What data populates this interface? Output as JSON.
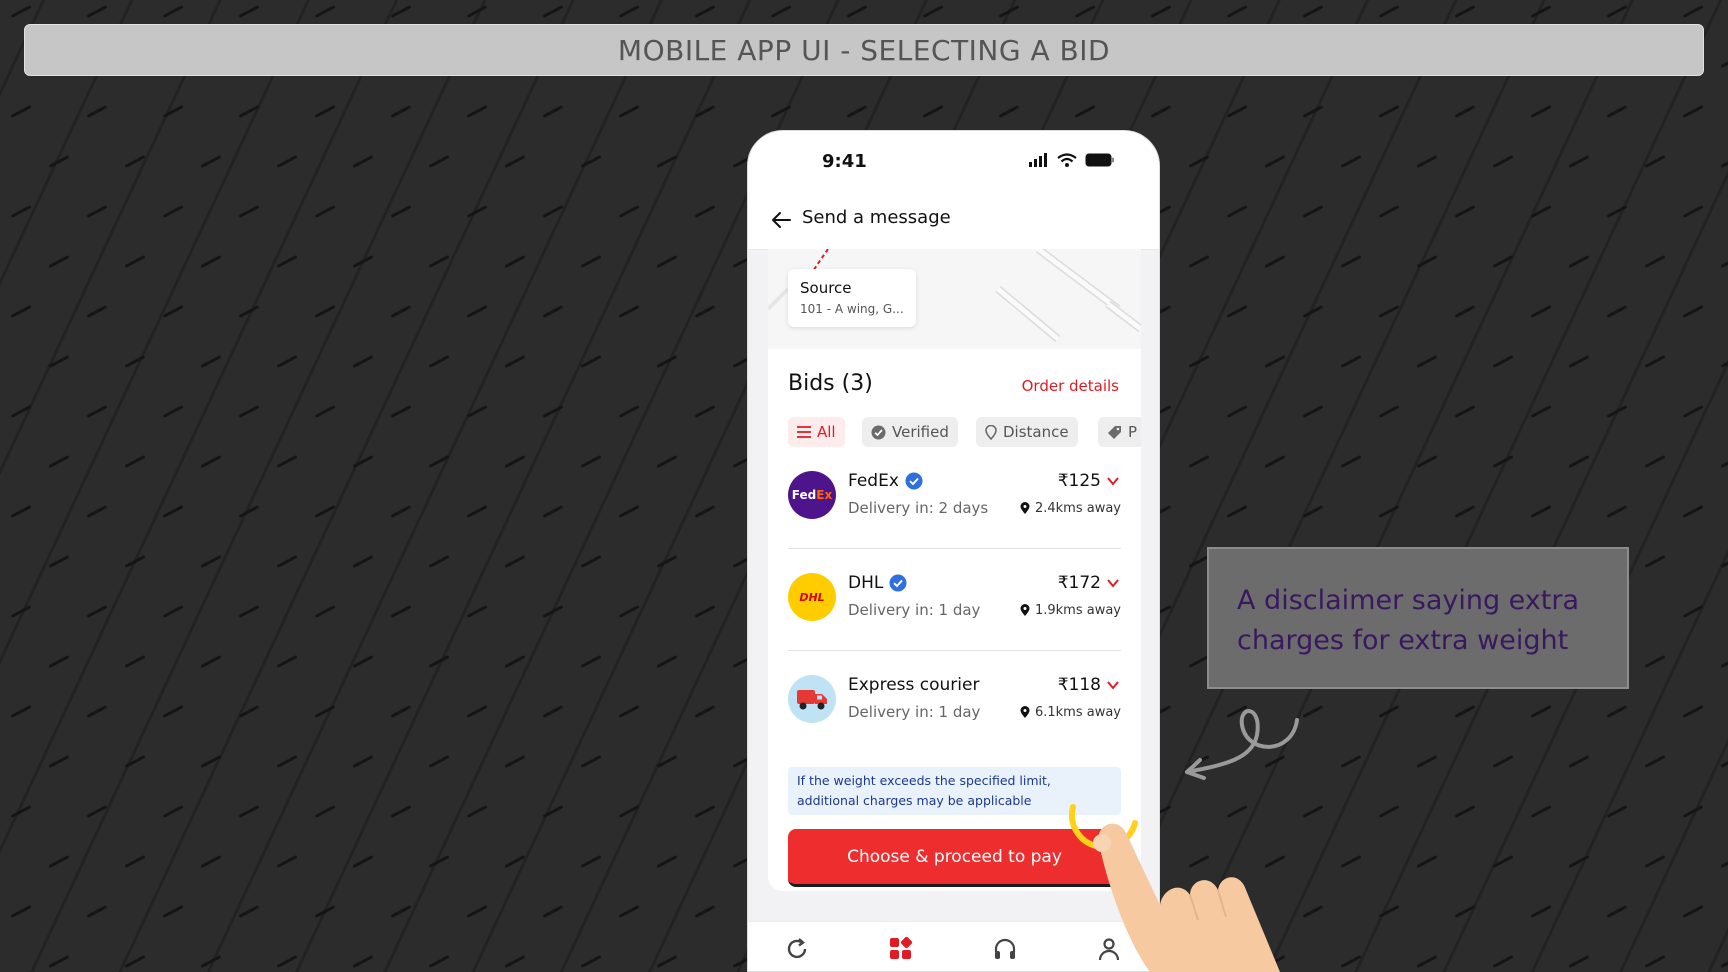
{
  "banner": {
    "title": "MOBILE APP UI - SELECTING A BID"
  },
  "phone": {
    "status": {
      "time": "9:41"
    },
    "nav": {
      "title": "Send a message"
    },
    "map": {
      "source_title": "Source",
      "source_address": "101 - A wing, G..."
    },
    "bids": {
      "title": "Bids (3)",
      "order_details": "Order details",
      "filters": [
        "All",
        "Verified",
        "Distance",
        "P"
      ],
      "items": [
        {
          "name": "FedEx",
          "verified": true,
          "delivery": "Delivery in: 2 days",
          "price": "₹125",
          "distance": "2.4kms away",
          "logo": "fedex-logo",
          "logo_color": "#4d148c"
        },
        {
          "name": "DHL",
          "verified": true,
          "delivery": "Delivery in: 1 day",
          "price": "₹172",
          "distance": "1.9kms away",
          "logo": "dhl-logo",
          "logo_color": "#ffcc00"
        },
        {
          "name": "Express courier",
          "verified": false,
          "delivery": "Delivery in: 1 day",
          "price": "₹118",
          "distance": "6.1kms away",
          "logo": "truck-logo",
          "logo_color": "#bfe3f5"
        }
      ]
    },
    "disclaimer": "If the weight exceeds the specified limit, additional charges may be applicable",
    "cta_label": "Choose & proceed to pay",
    "tabbar": [
      "refresh-icon",
      "grid-icon",
      "headphones-icon",
      "profile-icon"
    ]
  },
  "callout": {
    "text": "A disclaimer saying extra charges for extra weight"
  },
  "colors": {
    "accent": "#e01b24",
    "cta": "#ee2e2e",
    "verified": "#2f6fe0",
    "callout_text": "#3a1860"
  },
  "logo_text": {
    "fedex_fed": "Fed",
    "fedex_ex": "Ex",
    "dhl": "DHL"
  }
}
